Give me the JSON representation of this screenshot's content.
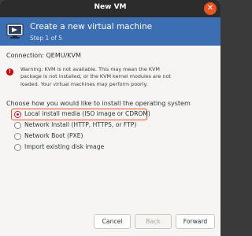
{
  "window": {
    "title": "New VM"
  },
  "header": {
    "heading": "Create a new virtual machine",
    "step": "Step 1 of 5",
    "icon": "monitor-icon",
    "color": "#3c6eb4"
  },
  "connection": {
    "text": "Connection:  QEMU/KVM"
  },
  "warning": {
    "icon": "error-icon",
    "line1": "Warning: KVM is not available. This may mean the KVM",
    "line2": "package is not installed, or the KVM kernel modules are not",
    "line3": "loaded. Your virtual machines may perform poorly."
  },
  "install": {
    "prompt": "Choose how you would like to install the operating system",
    "options": [
      {
        "label": "Local install media (ISO image or CDROM)",
        "selected": true
      },
      {
        "label": "Network Install (HTTP, HTTPS, or FTP)",
        "selected": false
      },
      {
        "label": "Network Boot (PXE)",
        "selected": false
      },
      {
        "label": "Import existing disk image",
        "selected": false
      }
    ]
  },
  "footer": {
    "cancel": "Cancel",
    "back": "Back",
    "forward": "Forward"
  }
}
